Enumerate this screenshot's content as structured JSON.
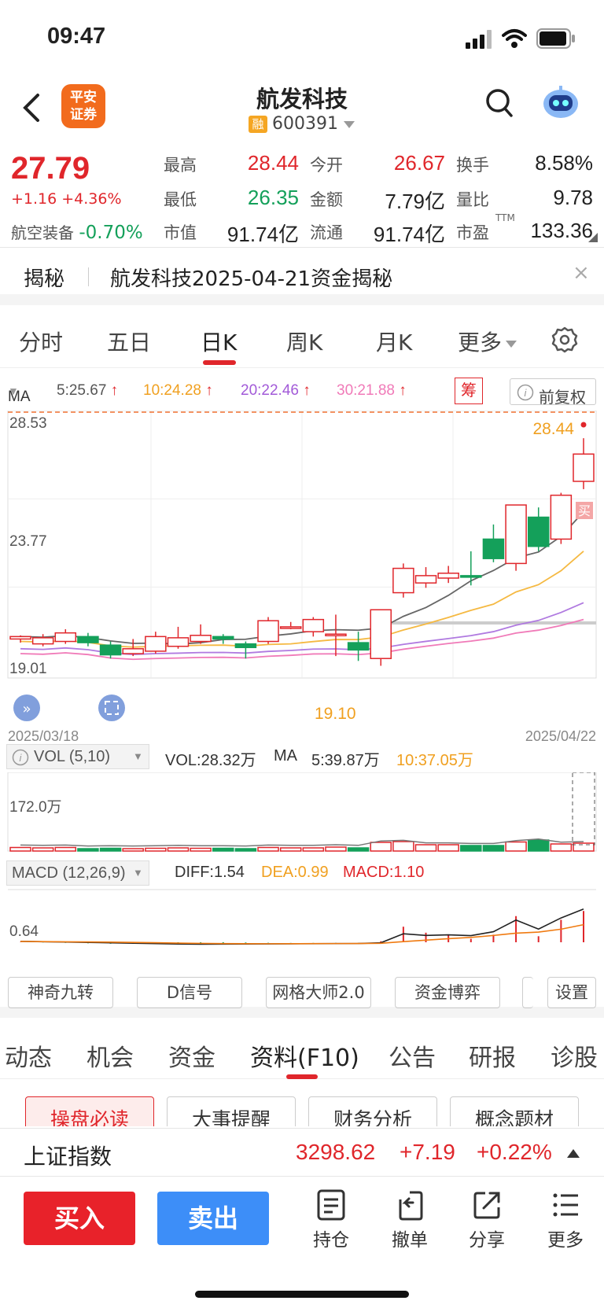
{
  "status": {
    "time": "09:47"
  },
  "header": {
    "logo_line1": "平安",
    "logo_line2": "证券",
    "title": "航发科技",
    "rong_badge": "融",
    "code": "600391"
  },
  "quote": {
    "price": "27.79",
    "change": "+1.16 +4.36%",
    "sector_name": "航空装备",
    "sector_change": "-0.70%",
    "labels": [
      "最高",
      "最低",
      "市值",
      "今开",
      "金额",
      "流通",
      "换手",
      "量比",
      "市盈"
    ],
    "high": "28.44",
    "low": "26.35",
    "market_cap": "91.74亿",
    "open": "26.67",
    "amount": "7.79亿",
    "float_cap": "91.74亿",
    "turnover": "8.58%",
    "volume_ratio": "9.78",
    "pe_sup": "TTM",
    "pe": "133.36"
  },
  "reveal": {
    "tag": "揭秘",
    "text": "航发科技2025-04-21资金揭秘",
    "close": "×"
  },
  "chart_tabs": [
    "分时",
    "五日",
    "日K",
    "周K",
    "月K",
    "更多"
  ],
  "active_chart_tab": "日K",
  "ma_legend": {
    "ma": "MA",
    "ma5": "5:25.67",
    "ma10": "10:24.28",
    "ma20": "20:22.46",
    "ma30": "30:21.88",
    "chip_button": "筹",
    "adjust": "前复权"
  },
  "colors": {
    "up": "#e0262b",
    "down": "#14a05a",
    "ma5": "#666666",
    "ma10": "#f5b942",
    "ma20": "#b07ae0",
    "ma30": "#f07ab8"
  },
  "chart_data": {
    "type": "candlestick",
    "y_axis_labels": [
      "28.53",
      "23.77",
      "19.01"
    ],
    "date_start": "2025/03/18",
    "date_end": "2025/04/22",
    "max_marker": "28.44",
    "min_marker": "19.10",
    "buy_marker": "买",
    "candles": [
      [
        20.2,
        20.3,
        20.05,
        20.35
      ],
      [
        20.0,
        20.25,
        19.9,
        20.4
      ],
      [
        20.1,
        20.45,
        20.0,
        20.6
      ],
      [
        20.3,
        20.05,
        19.9,
        20.45
      ],
      [
        19.95,
        19.55,
        19.4,
        20.1
      ],
      [
        19.6,
        19.8,
        19.5,
        20.2
      ],
      [
        19.7,
        20.3,
        19.6,
        20.5
      ],
      [
        19.9,
        20.25,
        19.8,
        20.7
      ],
      [
        20.1,
        20.35,
        20.0,
        20.8
      ],
      [
        20.3,
        20.2,
        20.0,
        20.4
      ],
      [
        20.0,
        19.85,
        19.4,
        20.1
      ],
      [
        20.1,
        20.95,
        20.0,
        21.1
      ],
      [
        20.7,
        20.7,
        20.6,
        20.9
      ],
      [
        20.5,
        21.0,
        20.3,
        21.1
      ],
      [
        20.4,
        20.4,
        19.5,
        21.2
      ],
      [
        20.05,
        19.75,
        19.3,
        20.5
      ],
      [
        19.4,
        21.4,
        19.1,
        21.4
      ],
      [
        22.1,
        23.1,
        21.9,
        23.3
      ],
      [
        22.5,
        22.8,
        22.3,
        23.15
      ],
      [
        22.7,
        22.9,
        22.5,
        23.2
      ],
      [
        22.8,
        22.75,
        22.4,
        23.8
      ],
      [
        24.3,
        23.5,
        23.35,
        24.9
      ],
      [
        23.3,
        25.7,
        23.0,
        25.7
      ],
      [
        25.2,
        24.0,
        23.8,
        25.6
      ],
      [
        24.3,
        26.1,
        24.1,
        26.2
      ],
      [
        26.67,
        27.79,
        26.35,
        28.44
      ]
    ],
    "volumes": [
      0.9,
      0.8,
      0.9,
      0.6,
      0.7,
      0.6,
      0.7,
      0.8,
      0.7,
      0.7,
      0.6,
      0.9,
      0.8,
      0.8,
      1.0,
      0.8,
      2.2,
      2.4,
      1.6,
      1.6,
      1.4,
      1.4,
      2.3,
      2.8,
      1.8,
      2.0
    ],
    "vol_axis_label": "172.0万",
    "macd_axis_label": "0.64"
  },
  "vol_legend": {
    "label": "VOL (5,10)",
    "vol": "VOL:28.32万",
    "ma": "MA",
    "ma5": "5:39.87万",
    "ma10": "10:37.05万"
  },
  "macd_legend": {
    "label": "MACD (12,26,9)",
    "diff": "DIFF:1.54",
    "dea": "DEA:0.99",
    "macd": "MACD:1.10"
  },
  "indicator_buttons": [
    "神奇九转",
    "D信号",
    "网格大师2.0",
    "资金博弈",
    "设置"
  ],
  "section_tabs": [
    "动态",
    "机会",
    "资金",
    "资料(F10)",
    "公告",
    "研报",
    "诊股"
  ],
  "active_section_tab": "资料(F10)",
  "f10_chips": [
    "操盘必读",
    "大事提醒",
    "财务分析",
    "概念题材"
  ],
  "index_bar": {
    "name": "上证指数",
    "value": "3298.62",
    "change": "+7.19",
    "pct": "+0.22%"
  },
  "bottom": {
    "buy": "买入",
    "sell": "卖出",
    "tools": [
      "持仓",
      "撤单",
      "分享",
      "更多"
    ]
  }
}
